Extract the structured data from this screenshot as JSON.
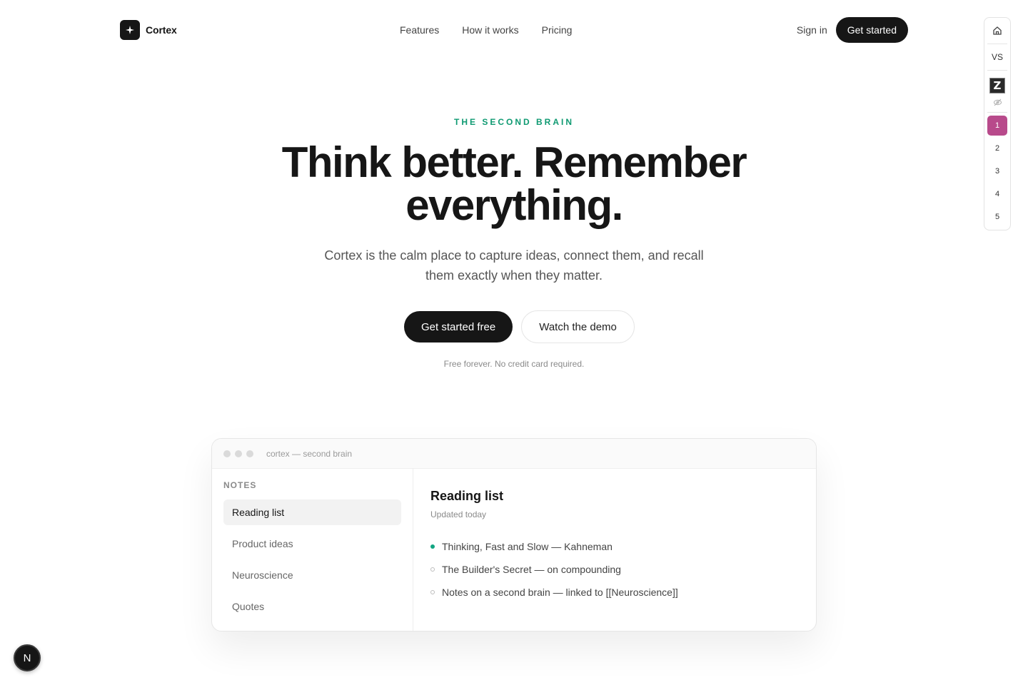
{
  "brand": {
    "name": "Cortex",
    "icon": "sparkle-icon"
  },
  "nav": {
    "links": [
      "Features",
      "How it works",
      "Pricing"
    ],
    "signin_label": "Sign in",
    "cta_label": "Get started"
  },
  "hero": {
    "eyebrow": "THE SECOND BRAIN",
    "headline_line1": "Think better. Remember",
    "headline_line2": "everything.",
    "subhead": "Cortex is the calm place to capture ideas, connect them, and recall them exactly when they matter.",
    "primary_cta": "Get started free",
    "secondary_cta": "Watch the demo",
    "fineprint": "Free forever. No credit card required."
  },
  "mock": {
    "window_title": "cortex — second brain",
    "sidebar_heading": "NOTES",
    "notes": [
      "Reading list",
      "Product ideas",
      "Neuroscience",
      "Quotes"
    ],
    "active_note": "Reading list",
    "note_title": "Reading list",
    "note_meta": "Updated today",
    "items": [
      {
        "text": "Thinking, Fast and Slow — Kahneman",
        "checked": true
      },
      {
        "text": "The Builder's Secret — on compounding",
        "checked": false
      },
      {
        "text": "Notes on a second brain — linked to [[Neuroscience]]",
        "checked": false
      }
    ],
    "accent_color": "#12a582"
  },
  "devpanel": {
    "icons": [
      "home-icon",
      "z-icon",
      "eye-off-icon"
    ],
    "vs_label": "VS",
    "z_label": "Z",
    "pages": [
      "1",
      "2",
      "3",
      "4",
      "5"
    ],
    "active_page": "1",
    "active_color": "#b84a8b"
  },
  "badge": {
    "label": "N"
  },
  "colors": {
    "accent": "#0f9a72",
    "dark": "#161616"
  }
}
